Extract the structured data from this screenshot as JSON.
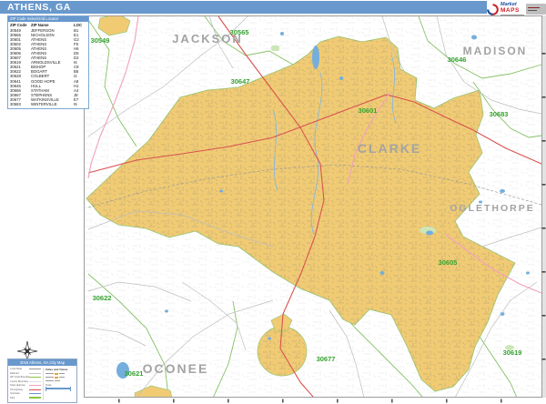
{
  "title_bar": {
    "title": "ATHENS, GA",
    "color": "#6898CC"
  },
  "logo": {
    "market": "Market",
    "maps": "MAPS"
  },
  "zip_table": {
    "panel_title": "ZIP Code Index/Grid Locator",
    "columns": [
      "ZIP Code",
      "ZIP Name",
      "LOC"
    ],
    "rows": [
      {
        "zip": "30549",
        "name": "JEFFERSON",
        "loc": "B1"
      },
      {
        "zip": "30565",
        "name": "NICHOLSON",
        "loc": "E1"
      },
      {
        "zip": "30601",
        "name": "ATHENS",
        "loc": "G2"
      },
      {
        "zip": "30602",
        "name": "ATHENS",
        "loc": "F5"
      },
      {
        "zip": "30605",
        "name": "ATHENS",
        "loc": "H6"
      },
      {
        "zip": "30606",
        "name": "ATHENS",
        "loc": "D5"
      },
      {
        "zip": "30607",
        "name": "ATHENS",
        "loc": "D2"
      },
      {
        "zip": "30619",
        "name": "ARNOLDSVILLE",
        "loc": "I6"
      },
      {
        "zip": "30621",
        "name": "BISHOP",
        "loc": "C8"
      },
      {
        "zip": "30622",
        "name": "BOGART",
        "loc": "B5"
      },
      {
        "zip": "30628",
        "name": "COLBERT",
        "loc": "I2"
      },
      {
        "zip": "30641",
        "name": "GOOD HOPE",
        "loc": "A8"
      },
      {
        "zip": "30646",
        "name": "HULL",
        "loc": "H1"
      },
      {
        "zip": "30666",
        "name": "STATHAM",
        "loc": "A4"
      },
      {
        "zip": "30667",
        "name": "STEPHENS",
        "loc": "J8"
      },
      {
        "zip": "30677",
        "name": "WATKINSVILLE",
        "loc": "E7"
      },
      {
        "zip": "30683",
        "name": "WINTERVILLE",
        "loc": "I5"
      }
    ]
  },
  "map": {
    "county_labels": [
      "JACKSON",
      "MADISON",
      "CLARKE",
      "OGLETHORPE",
      "OCONEE"
    ],
    "zip_labels": [
      "30549",
      "30565",
      "30646",
      "30647",
      "30601",
      "30683",
      "30605",
      "30622",
      "30677",
      "30619",
      "30621"
    ],
    "highlight_color": "#F0CB74",
    "zip_label_color": "#35A22F",
    "county_label_color": "#A3A3A3",
    "water_color": "#74AEDC",
    "highway_color": "#D9534F"
  },
  "legend": {
    "title": "2016 Athens, GA City Map",
    "left_items": [
      "Local Road",
      "Railroad",
      "ZIP Code Boundary",
      "County Boundary",
      "State Highway",
      "US Highway",
      "Interstate",
      "Park"
    ],
    "cities_header": "Cities and Towns",
    "scale_label": "Scale"
  }
}
